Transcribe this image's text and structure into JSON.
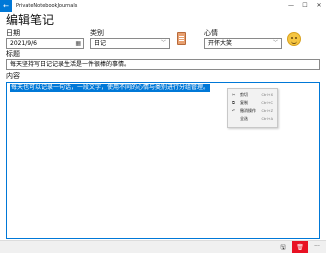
{
  "window": {
    "title": "PrivateNotebookJournals",
    "back_glyph": "←",
    "minimize_glyph": "—",
    "maximize_glyph": "☐",
    "close_glyph": "✕"
  },
  "page": {
    "title": "编辑笔记"
  },
  "form": {
    "date_label": "日期",
    "date_value": "2021/9/6",
    "category_label": "类别",
    "category_value": "日记",
    "mood_label": "心情",
    "mood_value": "开怀大笑",
    "title_label": "标题",
    "title_value": "每天坚持写日记记录生活是一件很棒的事情。",
    "content_label": "内容",
    "content_value": "每天也可以记录一句话，一段文字，使用不同的心情与类别进行分组管理。"
  },
  "context_menu": {
    "items": [
      {
        "label": "剪切",
        "shortcut": "Ctrl+X",
        "icon": "✂"
      },
      {
        "label": "复制",
        "shortcut": "Ctrl+C",
        "icon": "⧉"
      },
      {
        "label": "撤消操作",
        "shortcut": "Ctrl+Z",
        "icon": "↶"
      },
      {
        "label": "全选",
        "shortcut": "Ctrl+A",
        "icon": ""
      }
    ]
  },
  "commandbar": {
    "save_glyph": "🖫",
    "delete_glyph": "🗑",
    "more_glyph": "···"
  },
  "colors": {
    "accent": "#0078d7",
    "delete": "#e81123"
  }
}
